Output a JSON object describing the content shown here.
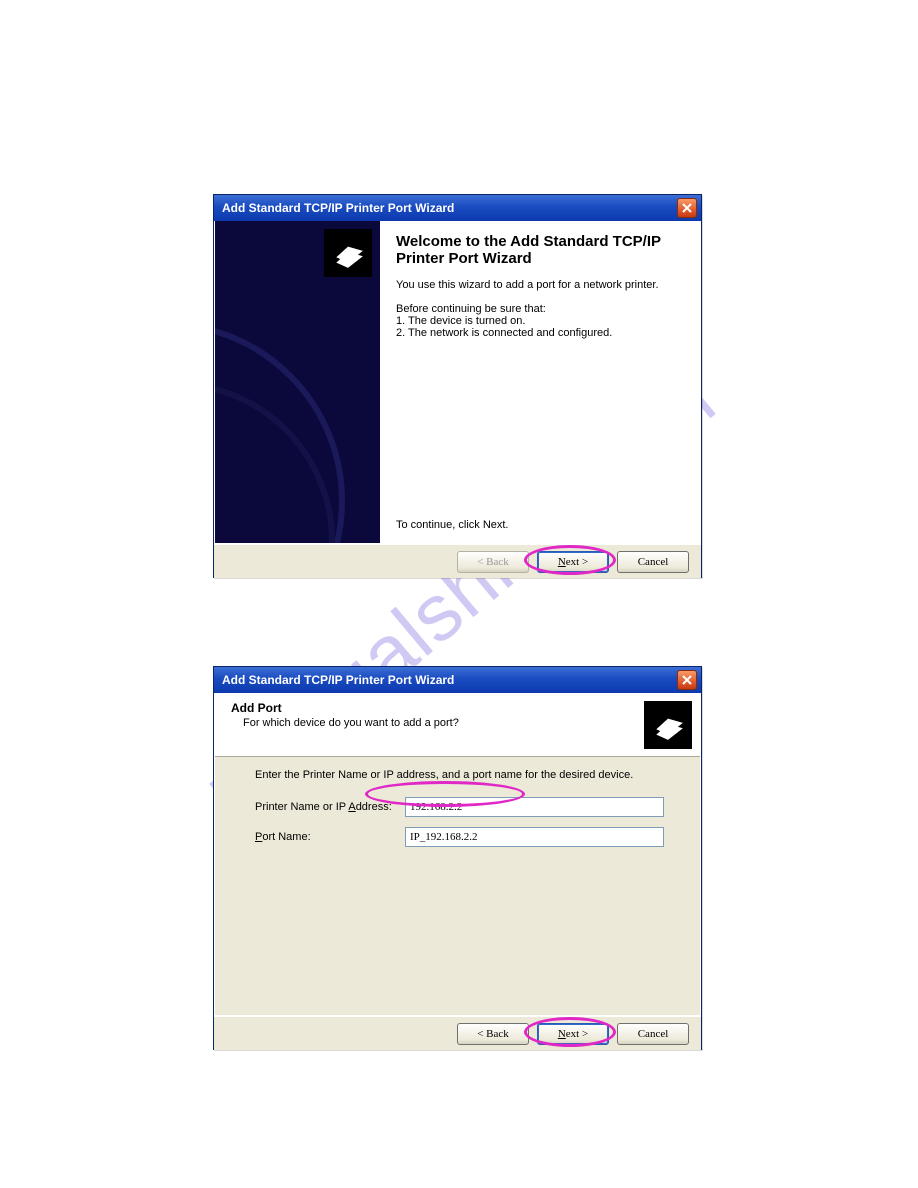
{
  "watermark": "manualshive.com",
  "dialog1": {
    "title": "Add Standard TCP/IP Printer Port Wizard",
    "heading": "Welcome to the Add Standard TCP/IP Printer Port Wizard",
    "intro": "You use this wizard to add a port for a network printer.",
    "before": "Before continuing be sure that:",
    "item1": "1.  The device is turned on.",
    "item2": "2.  The network is connected and configured.",
    "continue": "To continue, click Next.",
    "buttons": {
      "back": "< Back",
      "next": "Next >",
      "cancel": "Cancel"
    }
  },
  "dialog2": {
    "title": "Add Standard TCP/IP Printer Port Wizard",
    "header_title": "Add Port",
    "header_sub": "For which device do you want to add a port?",
    "instruction": "Enter the Printer Name or IP address, and a port name for the desired device.",
    "label_ip": "Printer Name or IP Address:",
    "label_port": "Port Name:",
    "value_ip": "192.168.2.2",
    "value_port": "IP_192.168.2.2",
    "buttons": {
      "back": "< Back",
      "next": "Next >",
      "cancel": "Cancel"
    }
  }
}
